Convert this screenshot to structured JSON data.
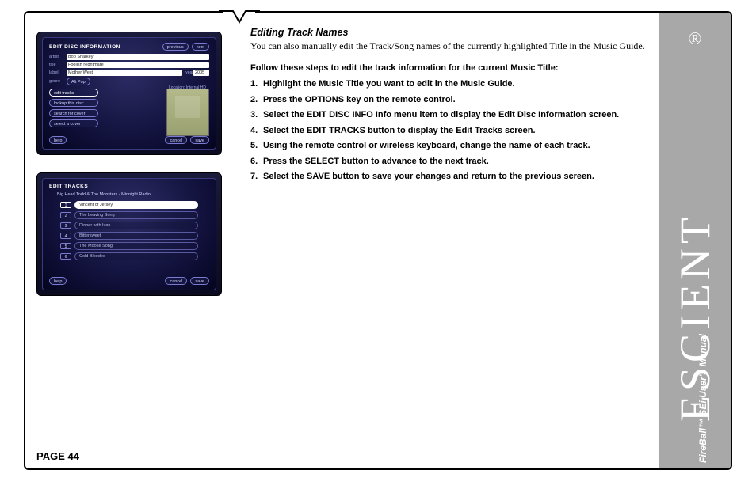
{
  "page_number": "PAGE 44",
  "brand": {
    "logo": "ESCIENT",
    "registered": "®",
    "subtitle": "FireBall™ SEi User's Manual"
  },
  "heading": "Editing Track Names",
  "intro": "You can also manually edit the Track/Song names of the currently highlighted Title in the Music Guide.",
  "lead": "Follow these steps to edit the track information for the current Music Title:",
  "steps": [
    "Highlight the Music Title you want to edit in the Music Guide.",
    "Press the OPTIONS key on the remote control.",
    "Select the EDIT DISC INFO Info menu item to display the Edit Disc Information screen.",
    "Select the EDIT TRACKS button to display the Edit Tracks screen.",
    "Using the remote control or wireless keyboard, change the name of each track.",
    "Press the SELECT button to advance to the next track.",
    "Select the SAVE button to save your changes and return to the previous screen."
  ],
  "shot1": {
    "title": "EDIT DISC INFORMATION",
    "nav": {
      "prev": "previous",
      "next": "next"
    },
    "fields": {
      "artist_lbl": "artist",
      "artist": "Bob Sharkey",
      "title_lbl": "title",
      "title": "Foolish Nightmare",
      "label_lbl": "label",
      "label": "Mother West",
      "year_lbl": "year",
      "year": "2005",
      "genre_lbl": "genre",
      "genre": "Alt Pop"
    },
    "location": "Location: Internal HD",
    "buttons": [
      "edit tracks",
      "lookup this disc",
      "search for cover",
      "select a cover"
    ],
    "footer": {
      "help": "help",
      "cancel": "cancel",
      "save": "save"
    }
  },
  "shot2": {
    "title": "EDIT TRACKS",
    "album": "Big Head Todd & The Monsters - Midnight Radio",
    "tracks": [
      {
        "n": "1",
        "name": "Vincent of Jersey",
        "selected": true
      },
      {
        "n": "2",
        "name": "The Leaving Song",
        "selected": false
      },
      {
        "n": "3",
        "name": "Dinner with Ivan",
        "selected": false
      },
      {
        "n": "4",
        "name": "Bittersweet",
        "selected": false
      },
      {
        "n": "5",
        "name": "The Moose Song",
        "selected": false
      },
      {
        "n": "6",
        "name": "Cold Blooded",
        "selected": false
      }
    ],
    "footer": {
      "help": "help",
      "cancel": "cancel",
      "save": "save"
    }
  }
}
